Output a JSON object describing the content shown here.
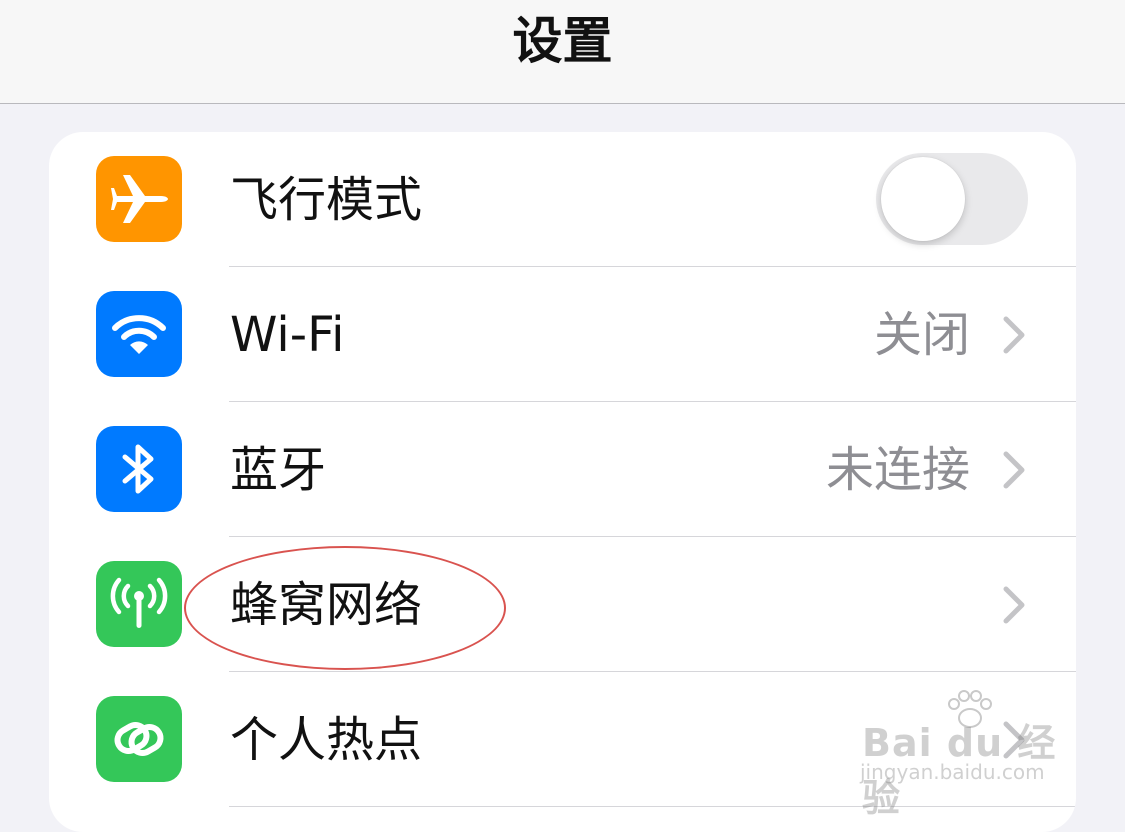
{
  "header": {
    "title": "设置"
  },
  "settings": {
    "airplane": {
      "label": "飞行模式",
      "icon": "airplane-icon",
      "icon_color": "#ff9500",
      "toggle_on": false
    },
    "wifi": {
      "label": "Wi-Fi",
      "value": "关闭",
      "icon": "wifi-icon",
      "icon_color": "#007aff"
    },
    "bluetooth": {
      "label": "蓝牙",
      "value": "未连接",
      "icon": "bluetooth-icon",
      "icon_color": "#007aff"
    },
    "cellular": {
      "label": "蜂窝网络",
      "icon": "cellular-antenna-icon",
      "icon_color": "#34c759"
    },
    "hotspot": {
      "label": "个人热点",
      "icon": "hotspot-link-icon",
      "icon_color": "#34c759"
    }
  },
  "annotation": {
    "color": "#d9534f",
    "target": "cellular"
  },
  "watermark": {
    "main": "Bai du 经验",
    "sub": "jingyan.baidu.com"
  }
}
